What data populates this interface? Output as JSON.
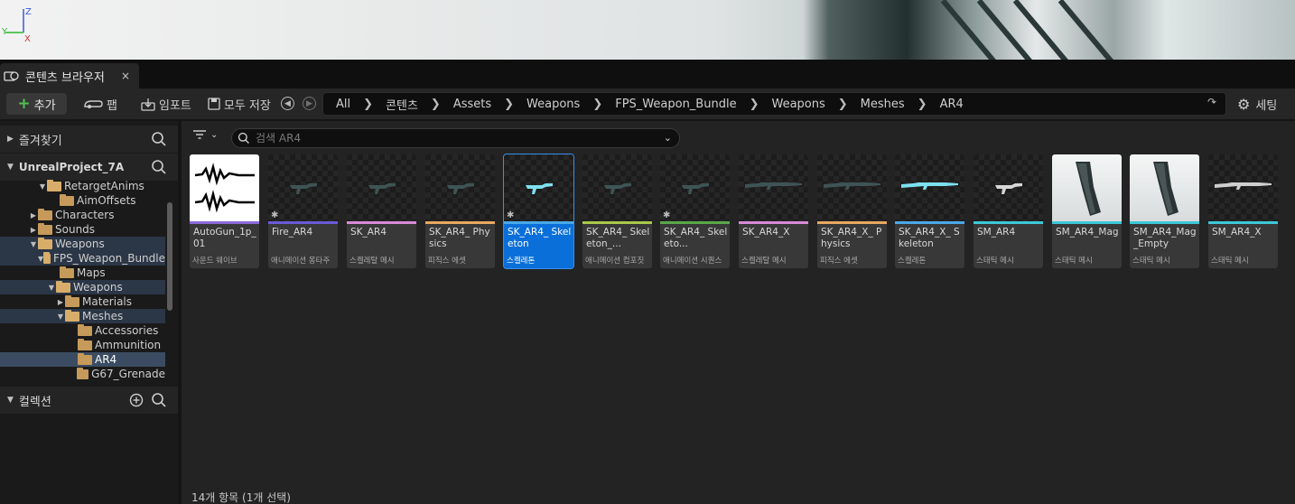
{
  "tab": {
    "title": "콘텐츠 브라우저",
    "close": "×"
  },
  "toolbar": {
    "add_label": "추가",
    "fab_label": "팹",
    "import_label": "임포트",
    "save_all_label": "모두 저장",
    "settings_label": "세팅"
  },
  "breadcrumb": [
    "All",
    "콘텐츠",
    "Assets",
    "Weapons",
    "FPS_Weapon_Bundle",
    "Weapons",
    "Meshes",
    "AR4"
  ],
  "favorites": {
    "label": "즐겨찾기"
  },
  "project": {
    "label": "UnrealProject_7A"
  },
  "collections": {
    "label": "컬렉션"
  },
  "tree": [
    {
      "label": "RetargetAnims",
      "arrow": "▼",
      "open": true
    },
    {
      "label": "AimOffsets",
      "arrow": "",
      "open": false
    },
    {
      "label": "Characters",
      "arrow": "▶",
      "open": false
    },
    {
      "label": "Sounds",
      "arrow": "▶",
      "open": false
    },
    {
      "label": "Weapons",
      "arrow": "▼",
      "open": true
    },
    {
      "label": "FPS_Weapon_Bundle",
      "arrow": "▼",
      "open": true
    },
    {
      "label": "Maps",
      "arrow": "",
      "open": false
    },
    {
      "label": "Weapons",
      "arrow": "▼",
      "open": true
    },
    {
      "label": "Materials",
      "arrow": "▶",
      "open": false
    },
    {
      "label": "Meshes",
      "arrow": "▼",
      "open": true
    },
    {
      "label": "Accessories",
      "arrow": "",
      "open": false
    },
    {
      "label": "Ammunition",
      "arrow": "",
      "open": false
    },
    {
      "label": "AR4",
      "arrow": "",
      "open": false
    },
    {
      "label": "G67_Grenade",
      "arrow": "",
      "open": false
    }
  ],
  "search": {
    "placeholder": "검색 AR4"
  },
  "assets": [
    {
      "name": "AutoGun_1p_01",
      "type": "사운드 웨이브",
      "color": "#8c6ad8",
      "thumb": "wave"
    },
    {
      "name": "Fire_AR4",
      "type": "애니메이션 몽타주",
      "color": "#6a5ad8",
      "thumb": "gun",
      "badge": true
    },
    {
      "name": "SK_AR4",
      "type": "스켈레탈 메시",
      "color": "#d88ad8",
      "thumb": "gun"
    },
    {
      "name": "SK_AR4_ Physics",
      "type": "피직스 에셋",
      "color": "#e8a860",
      "thumb": "gun"
    },
    {
      "name": "SK_AR4_ Skeleton",
      "type": "스켈레톤",
      "color": "#4aa8e8",
      "thumb": "skel",
      "badge": true,
      "selected": true
    },
    {
      "name": "SK_AR4_ Skeleton_...",
      "type": "애니메이션 컴포짓",
      "color": "#a8c84a",
      "thumb": "gun"
    },
    {
      "name": "SK_AR4_ Skeleto...",
      "type": "애니메이션 시퀀스",
      "color": "#5aa84a",
      "thumb": "gun",
      "badge": true
    },
    {
      "name": "SK_AR4_X",
      "type": "스켈레탈 메시",
      "color": "#d88ad8",
      "thumb": "rifle"
    },
    {
      "name": "SK_AR4_X_ Physics",
      "type": "피직스 에셋",
      "color": "#e8a860",
      "thumb": "rifle"
    },
    {
      "name": "SK_AR4_X_ Skeleton",
      "type": "스켈레톤",
      "color": "#4aa8e8",
      "thumb": "skelrifle"
    },
    {
      "name": "SM_AR4",
      "type": "스태틱 메시",
      "color": "#3ec8d8",
      "thumb": "gunwhite"
    },
    {
      "name": "SM_AR4_Mag",
      "type": "스태틱 메시",
      "color": "#3ec8d8",
      "thumb": "mag"
    },
    {
      "name": "SM_AR4_Mag _Empty",
      "type": "스태틱 메시",
      "color": "#3ec8d8",
      "thumb": "mag"
    },
    {
      "name": "SM_AR4_X",
      "type": "스태틱 메시",
      "color": "#3ec8d8",
      "thumb": "riflewhite"
    }
  ],
  "status": "14개 항목 (1개 선택)"
}
